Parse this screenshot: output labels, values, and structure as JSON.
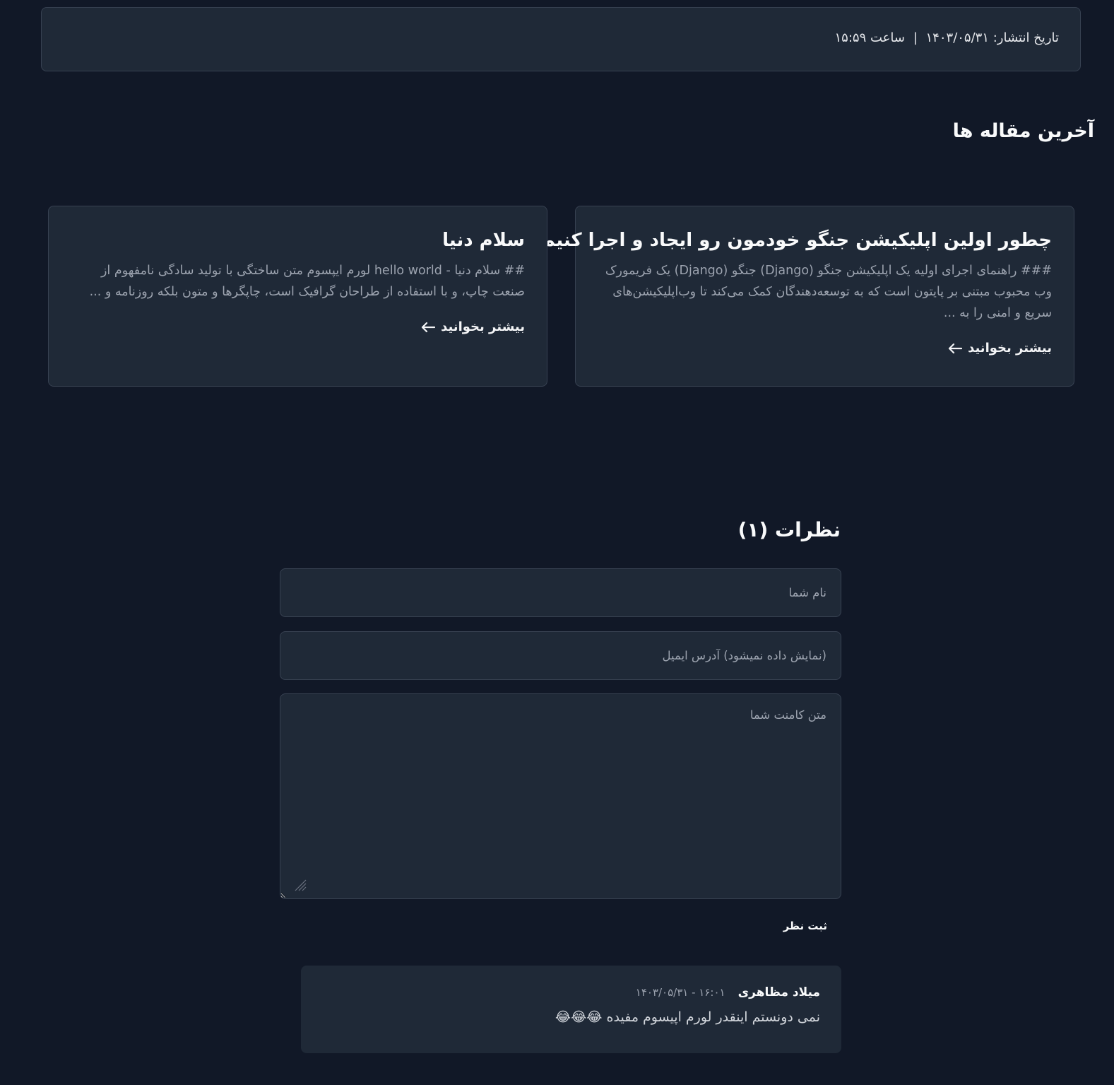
{
  "post": {
    "publish_label": "تاریخ انتشار: ۱۴۰۳/۰۵/۳۱",
    "separator": "|",
    "time_label": "ساعت ۱۵:۵۹"
  },
  "latest": {
    "title": "آخرین مقاله ها",
    "articles": [
      {
        "title": "چطور اولین اپلیکیشن جنگو خودمون رو ایجاد و اجرا کنیم؟",
        "excerpt": "### راهنمای اجرای اولیه یک اپلیکیشن جنگو (Django) جنگو (Django) یک فریمورک وب محبوب مبتنی بر پایتون است که به توسعه‌دهندگان کمک می‌کند تا وب‌اپلیکیشن‌های سریع و امنی را به ...",
        "more_label": "بیشتر بخوانید",
        "arrow_icon": "arrow-left-icon"
      },
      {
        "title": "سلام دنیا",
        "excerpt": "## سلام دنیا - hello world لورم ایپسوم متن ساختگی با تولید سادگی نامفهوم از صنعت چاپ، و با استفاده از طراحان گرافیک است، چاپگرها و متون بلکه روزنامه و ...",
        "more_label": "بیشتر بخوانید",
        "arrow_icon": "arrow-left-icon"
      }
    ]
  },
  "comments": {
    "title": "نظرات (۱)",
    "form": {
      "name_placeholder": "نام شما",
      "email_placeholder": "(نمایش داده نمیشود) آدرس ایمیل",
      "comment_placeholder": "متن کامنت شما",
      "submit_label": "ثبت نظر"
    },
    "items": [
      {
        "author": "میلاد مظاهری",
        "meta": "۱۶:۰۱ - ۱۴۰۳/۰۵/۳۱",
        "text": "نمی دونستم اینقدر لورم اپیسوم مفیده 😂😂😂"
      }
    ]
  },
  "colors": {
    "background": "#111827",
    "card": "#1f2937",
    "border": "#374151",
    "text_muted": "#9ca3af",
    "text_strong": "#f9fafb"
  }
}
